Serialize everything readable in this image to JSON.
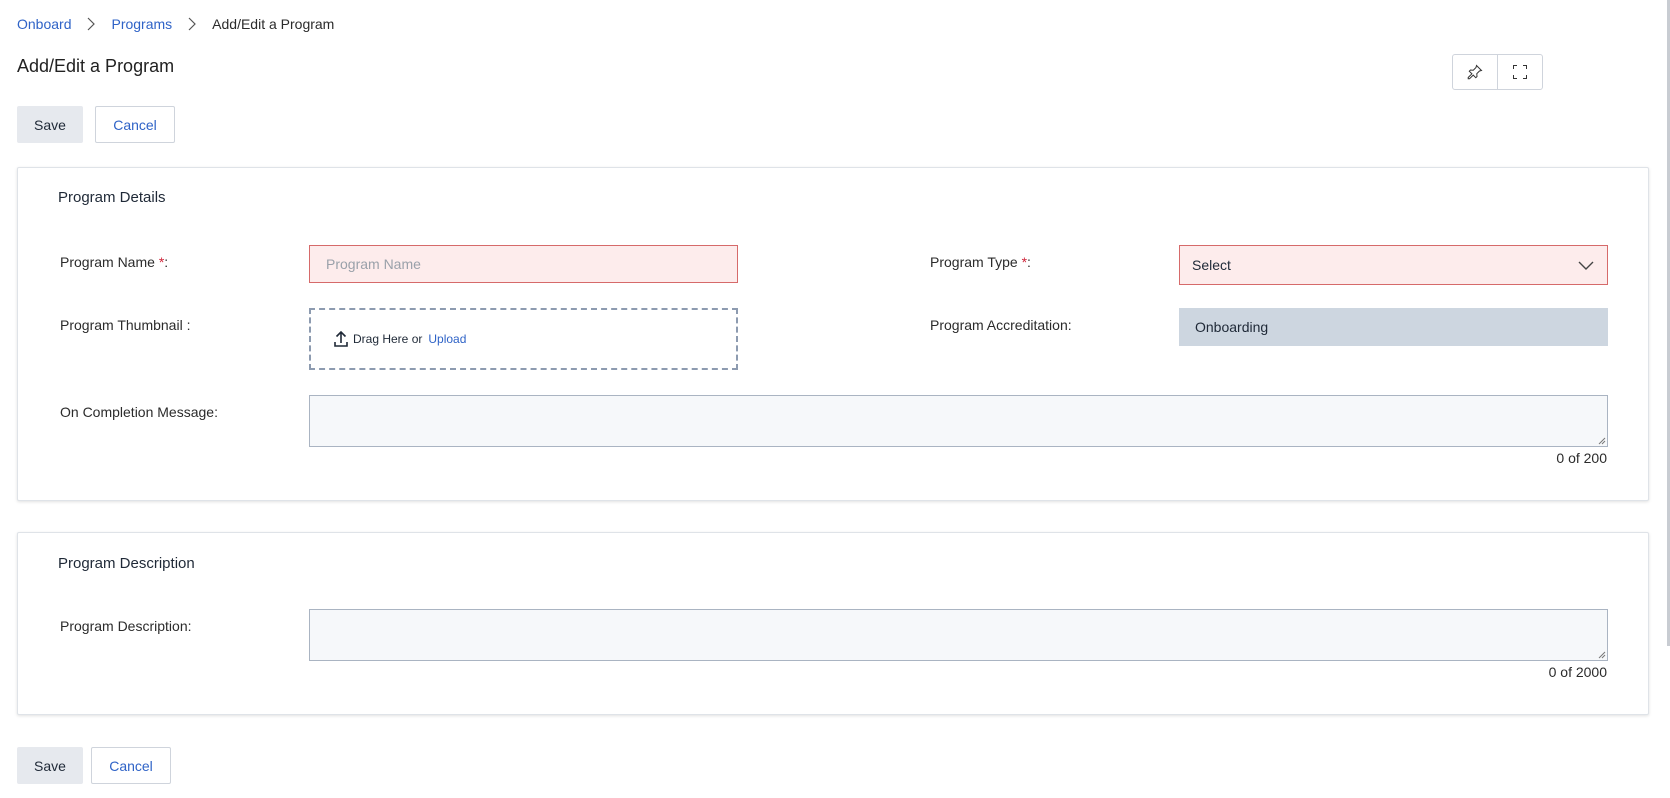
{
  "breadcrumb": {
    "items": [
      "Onboard",
      "Programs"
    ],
    "current": "Add/Edit a Program"
  },
  "page": {
    "title": "Add/Edit a Program"
  },
  "actions": {
    "save_label": "Save",
    "cancel_label": "Cancel"
  },
  "top_icons": [
    "pin-icon",
    "fullscreen-icon"
  ],
  "details": {
    "title": "Program Details",
    "name_label": "Program Name ",
    "name_placeholder": "Program Name",
    "type_label": "Program Type ",
    "type_value": "Select",
    "thumbnail_label": "Program Thumbnail :",
    "drag_text": "Drag Here or",
    "upload_text": "Upload",
    "accreditation_label": "Program Accreditation:",
    "accreditation_value": "Onboarding",
    "completion_label": "On Completion Message:",
    "completion_counter": "0 of 200",
    "required_mark": "*",
    "required_suffix": ":"
  },
  "description": {
    "title": "Program Description",
    "label": "Program Description:",
    "counter": "0 of 2000"
  },
  "colors": {
    "link": "#2f63c7",
    "error_bg": "#fdecec",
    "error_border": "#d66a6a",
    "readonly_bg": "#cdd6e0",
    "required": "#d0253a"
  }
}
